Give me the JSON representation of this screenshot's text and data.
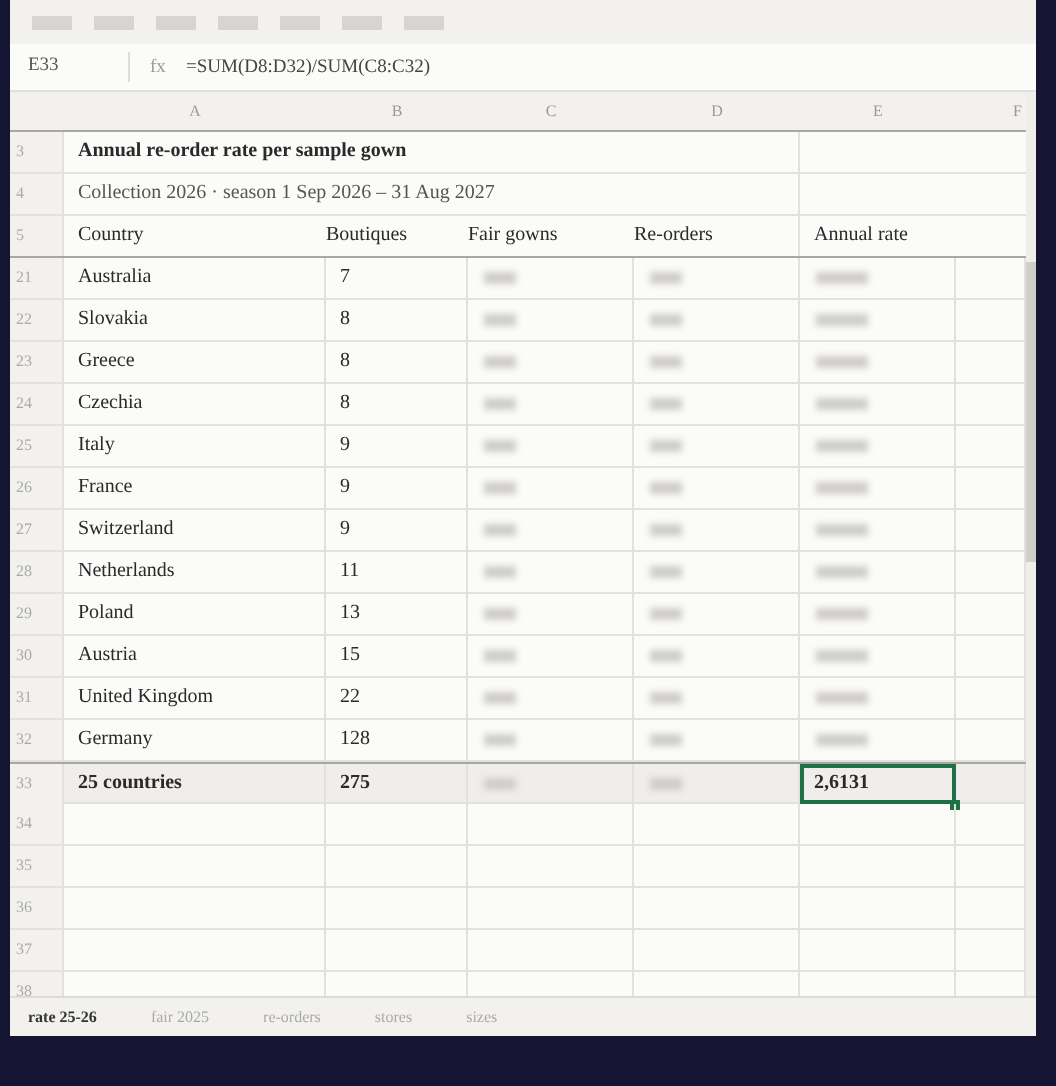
{
  "toolbar": {
    "menu_items": [
      {
        "kind": "placeholder"
      },
      {
        "kind": "placeholder"
      },
      {
        "kind": "placeholder"
      },
      {
        "kind": "placeholder"
      },
      {
        "kind": "placeholder"
      },
      {
        "kind": "placeholder"
      },
      {
        "kind": "placeholder"
      }
    ]
  },
  "formula_bar": {
    "cell_ref": "E33",
    "fx_label": "fx",
    "formula": "=SUM(D8:D32)/SUM(C8:C32)"
  },
  "column_headers": [
    "A",
    "B",
    "C",
    "D",
    "E",
    "F"
  ],
  "rows": [
    {
      "number": "3",
      "kind": "title",
      "text": "Annual re-order rate per sample gown"
    },
    {
      "number": "4",
      "kind": "subtitle",
      "text": "Collection 2026 · season 1 Sep 2026 – 31 Aug 2027"
    },
    {
      "number": "5",
      "kind": "header",
      "cells": [
        "Country",
        "Boutiques",
        "Fair gowns",
        "Re-orders",
        "Annual rate"
      ]
    },
    {
      "number": "21",
      "kind": "data",
      "country": "Australia",
      "boutiques": "7",
      "blurred": true
    },
    {
      "number": "22",
      "kind": "data",
      "country": "Slovakia",
      "boutiques": "8",
      "blurred": true
    },
    {
      "number": "23",
      "kind": "data",
      "country": "Greece",
      "boutiques": "8",
      "blurred": true
    },
    {
      "number": "24",
      "kind": "data",
      "country": "Czechia",
      "boutiques": "8",
      "blurred": true
    },
    {
      "number": "25",
      "kind": "data",
      "country": "Italy",
      "boutiques": "9",
      "blurred": true
    },
    {
      "number": "26",
      "kind": "data",
      "country": "France",
      "boutiques": "9",
      "blurred": true
    },
    {
      "number": "27",
      "kind": "data",
      "country": "Switzerland",
      "boutiques": "9",
      "blurred": true
    },
    {
      "number": "28",
      "kind": "data",
      "country": "Netherlands",
      "boutiques": "11",
      "blurred": true
    },
    {
      "number": "29",
      "kind": "data",
      "country": "Poland",
      "boutiques": "13",
      "blurred": true
    },
    {
      "number": "30",
      "kind": "data",
      "country": "Austria",
      "boutiques": "15",
      "blurred": true
    },
    {
      "number": "31",
      "kind": "data",
      "country": "United Kingdom",
      "boutiques": "22",
      "blurred": true
    },
    {
      "number": "32",
      "kind": "data",
      "country": "Germany",
      "boutiques": "128",
      "blurred": true
    },
    {
      "number": "33",
      "kind": "total",
      "country": "25 countries",
      "boutiques": "275",
      "blurred": true,
      "rate": "2,6131",
      "rate_selected": true
    },
    {
      "number": "34",
      "kind": "empty"
    },
    {
      "number": "35",
      "kind": "empty"
    },
    {
      "number": "36",
      "kind": "empty"
    },
    {
      "number": "37",
      "kind": "empty"
    },
    {
      "number": "38",
      "kind": "empty"
    }
  ],
  "sheet_tabs": [
    {
      "label": "rate 25-26",
      "selected": true
    },
    {
      "label": "fair 2025",
      "selected": false
    },
    {
      "label": "re-orders",
      "selected": false
    },
    {
      "label": "stores",
      "selected": false
    },
    {
      "label": "sizes",
      "selected": false
    }
  ]
}
